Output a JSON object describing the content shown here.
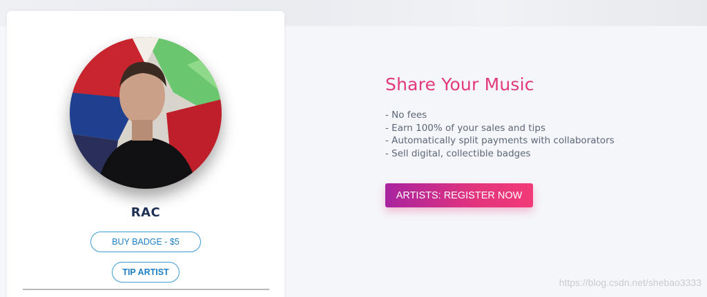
{
  "card": {
    "artist_name": "RAC",
    "buy_badge_label": "BUY BADGE - $5",
    "tip_artist_label": "TIP ARTIST"
  },
  "promo": {
    "title": "Share Your Music",
    "features": [
      "- No fees",
      "- Earn 100% of your sales and tips",
      "- Automatically split payments with collaborators",
      "- Sell digital, collectible badges"
    ],
    "register_label": "ARTISTS: REGISTER NOW"
  },
  "watermark": "https://blog.csdn.net/shebao3333",
  "colors": {
    "accent_pink": "#e2397c",
    "accent_purple": "#a8239f",
    "link_blue": "#1d7fc4",
    "name_navy": "#1f3055"
  }
}
